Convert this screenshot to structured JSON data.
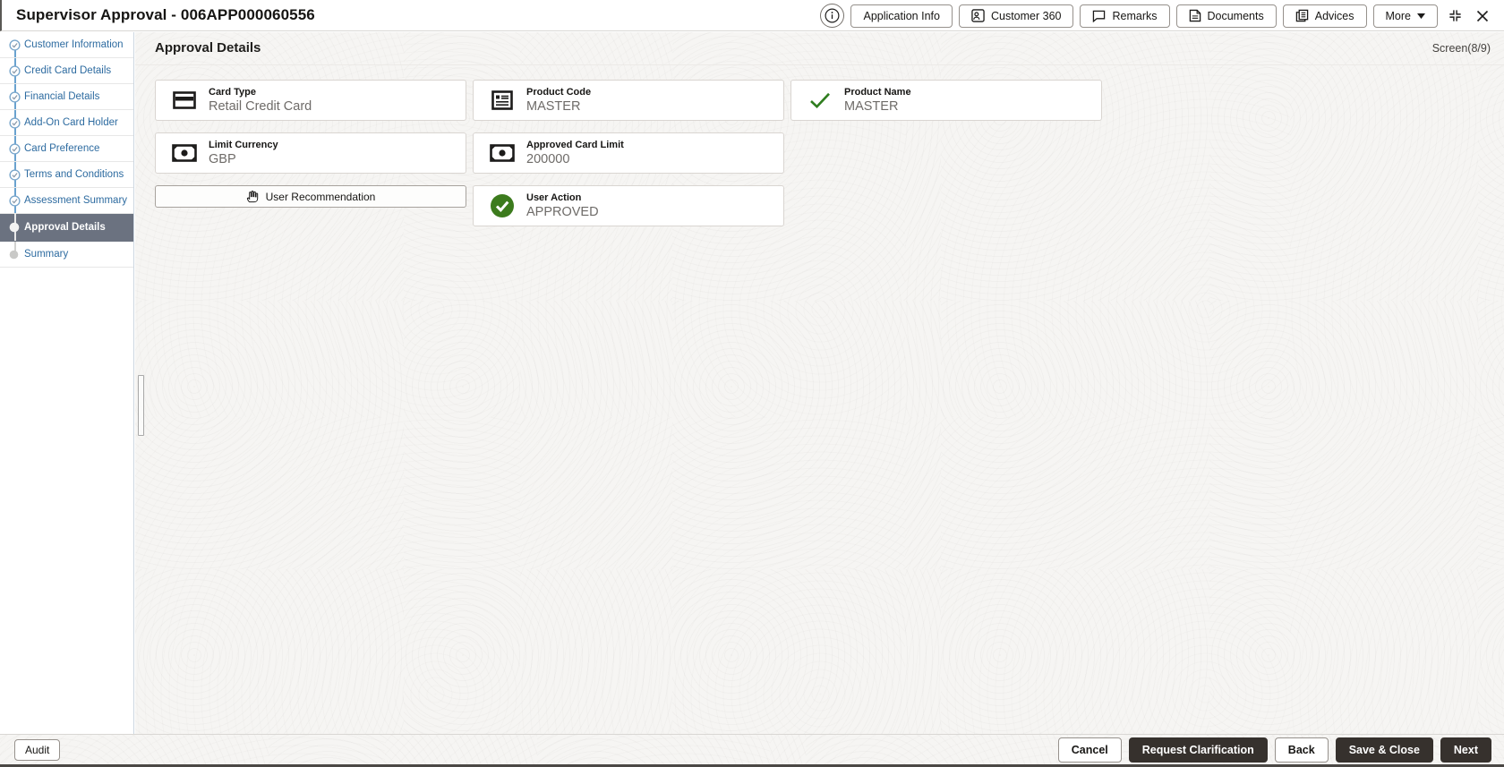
{
  "header": {
    "title": "Supervisor Approval - 006APP000060556",
    "actions": [
      {
        "label": "Application Info",
        "icon": "none"
      },
      {
        "label": "Customer 360",
        "icon": "customer-360-icon"
      },
      {
        "label": "Remarks",
        "icon": "remarks-icon"
      },
      {
        "label": "Documents",
        "icon": "documents-icon"
      },
      {
        "label": "Advices",
        "icon": "advices-icon"
      }
    ],
    "more_label": "More"
  },
  "sidebar": {
    "items": [
      {
        "label": "Customer Information",
        "state": "completed"
      },
      {
        "label": "Credit Card Details",
        "state": "completed"
      },
      {
        "label": "Financial Details",
        "state": "completed"
      },
      {
        "label": "Add-On Card Holder",
        "state": "completed"
      },
      {
        "label": "Card Preference",
        "state": "completed"
      },
      {
        "label": "Terms and Conditions",
        "state": "completed"
      },
      {
        "label": "Assessment Summary",
        "state": "completed"
      },
      {
        "label": "Approval Details",
        "state": "active"
      },
      {
        "label": "Summary",
        "state": "upcoming"
      }
    ]
  },
  "main": {
    "section_title": "Approval Details",
    "screen_indicator": "Screen(8/9)",
    "fields": [
      {
        "label": "Card Type",
        "value": "Retail Credit Card",
        "icon": "credit-card-icon"
      },
      {
        "label": "Product Code",
        "value": "MASTER",
        "icon": "product-form-icon"
      },
      {
        "label": "Product Name",
        "value": "MASTER",
        "icon": "green-check-icon"
      },
      {
        "label": "Limit Currency",
        "value": "GBP",
        "icon": "banknote-icon"
      },
      {
        "label": "Approved Card Limit",
        "value": "200000",
        "icon": "banknote-icon"
      },
      {
        "label": "User Action",
        "value": "APPROVED",
        "icon": "approved-circle-check-icon"
      }
    ],
    "user_recommendation_label": "User Recommendation"
  },
  "footer": {
    "audit_label": "Audit",
    "buttons": [
      {
        "label": "Cancel",
        "style": "secondary"
      },
      {
        "label": "Request Clarification",
        "style": "primary"
      },
      {
        "label": "Back",
        "style": "secondary"
      },
      {
        "label": "Save & Close",
        "style": "primary"
      },
      {
        "label": "Next",
        "style": "primary"
      }
    ]
  },
  "colors": {
    "primary_button": "#36312d",
    "active_step_bg": "#6b7280",
    "step_link_blue": "#2d6ba0",
    "success_green": "#3c7b1d",
    "connector_blue": "#6aa2cf"
  }
}
